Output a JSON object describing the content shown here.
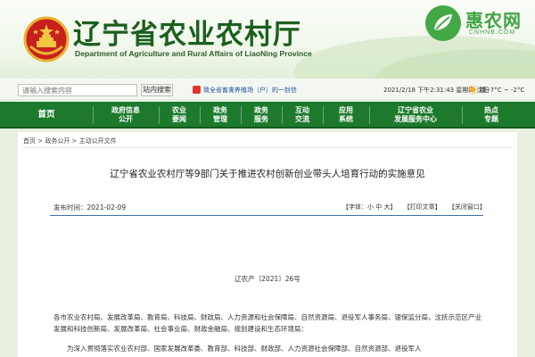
{
  "header": {
    "title": "辽宁省农业农村厅",
    "subtitle": "Department of Agriculture and Rural Affairs of LiaoNing Province",
    "emblem_icon": "national-emblem-icon",
    "colors": {
      "title": "#1b5f1e",
      "nav": "#1d7a2c"
    }
  },
  "watermark": {
    "title": "惠农网",
    "url": "CNHNB.COM",
    "logo_icon": "leaf-logo-icon"
  },
  "topbar": {
    "search_placeholder": "请输入搜索内容",
    "search_button": "站内搜索",
    "notice": "致全省畜禽养殖场（户）的一封信",
    "datetime": "2021/2/18 下午2:31:43 星期四",
    "city": "沈阳",
    "weather": "晴 -7°C ~ -2°C"
  },
  "nav": {
    "items": [
      {
        "label": "首页"
      },
      {
        "label": "政府信息\n公开"
      },
      {
        "label": "农业\n要闻"
      },
      {
        "label": "政务\n管理"
      },
      {
        "label": "政务\n服务"
      },
      {
        "label": "互动\n交流"
      },
      {
        "label": "应用\n系统"
      },
      {
        "label": "辽宁省农业\n发展服务中心"
      },
      {
        "label": "热点\n专题"
      }
    ]
  },
  "breadcrumb": {
    "home": "首页",
    "sep1": " > ",
    "level1": "政务公开",
    "sep2": " > ",
    "level2": "主动公开文件"
  },
  "article": {
    "title": "辽宁省农业农村厅等9部门关于推进农村创新创业带头人培育行动的实施意见",
    "date_label": "发布时间：",
    "date": "2021-02-09",
    "font_size": "【字体：小 中 大】",
    "print": "【打印文章】",
    "close": "【关闭窗口】",
    "doc_number": "辽农产〔2021〕26号",
    "paragraph1": "各市农业农村局、发展改革局、教育局、科技局、财政局、人力资源和社会保障局、自然资源局、退役军人事务局、银保监分局，沈抚示范区产业发展和科技创新局、发展改革局、社会事业局、财政金融局、规划建设和生态环境局：",
    "paragraph2": "为深入贯彻落实农业农村部、国家发展改革委、教育部、科技部、财政部、人力资源社会保障部、自然资源部、退役军人"
  }
}
